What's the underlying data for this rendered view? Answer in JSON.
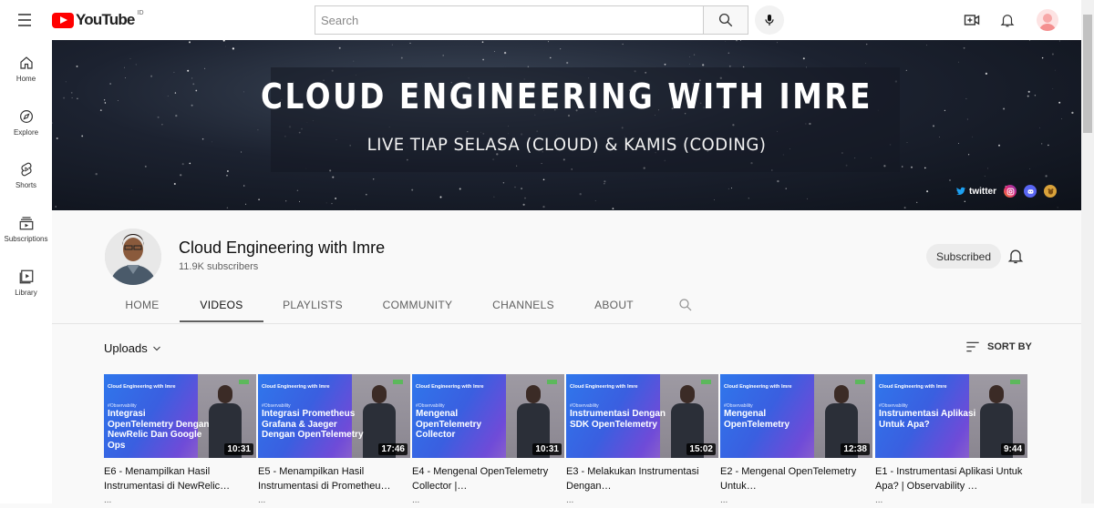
{
  "header": {
    "logo_text": "YouTube",
    "country_code": "ID",
    "search_placeholder": "Search",
    "icons": [
      "menu-icon",
      "search-icon",
      "mic-icon",
      "create-video-icon",
      "notifications-bell-icon",
      "avatar"
    ]
  },
  "sidebar": {
    "items": [
      {
        "label": "Home",
        "icon": "home-icon"
      },
      {
        "label": "Explore",
        "icon": "explore-compass-icon"
      },
      {
        "label": "Shorts",
        "icon": "shorts-icon"
      },
      {
        "label": "Subscriptions",
        "icon": "subscriptions-icon"
      },
      {
        "label": "Library",
        "icon": "library-icon"
      }
    ]
  },
  "banner": {
    "title": "CLOUD ENGINEERING WITH IMRE",
    "subtitle": "LIVE TIAP SELASA (CLOUD) & KAMIS (CODING)",
    "links": [
      {
        "label": "twitter",
        "icon": "twitter-icon"
      },
      {
        "label": "",
        "icon": "instagram-icon"
      },
      {
        "label": "",
        "icon": "discord-icon"
      },
      {
        "label": "",
        "icon": "web-icon"
      }
    ]
  },
  "channel": {
    "name": "Cloud Engineering with Imre",
    "subscribers": "11.9K subscribers",
    "subscribe_label": "Subscribed"
  },
  "tabs": [
    {
      "label": "HOME",
      "active": false
    },
    {
      "label": "VIDEOS",
      "active": true
    },
    {
      "label": "PLAYLISTS",
      "active": false
    },
    {
      "label": "COMMUNITY",
      "active": false
    },
    {
      "label": "CHANNELS",
      "active": false
    },
    {
      "label": "ABOUT",
      "active": false
    }
  ],
  "content": {
    "uploads_label": "Uploads",
    "sort_label": "SORT BY"
  },
  "videos": [
    {
      "thumb_top": "Cloud Engineering with Imre",
      "tag": "#Observability",
      "thumb_title": "Integrasi OpenTelemetry Dengan NewRelic Dan Google Ops",
      "duration": "10:31",
      "title": "E6 - Menampilkan Hasil Instrumentasi di NewRelic…",
      "meta": "..."
    },
    {
      "thumb_top": "Cloud Engineering with Imre",
      "tag": "#Observability",
      "thumb_title": "Integrasi Prometheus Grafana & Jaeger Dengan OpenTelemetry",
      "duration": "17:46",
      "title": "E5 - Menampilkan Hasil Instrumentasi di Prometheu…",
      "meta": "..."
    },
    {
      "thumb_top": "Cloud Engineering with Imre",
      "tag": "#Observability",
      "thumb_title": "Mengenal OpenTelemetry Collector",
      "duration": "10:31",
      "title": "E4 - Mengenal OpenTelemetry Collector |…",
      "meta": "..."
    },
    {
      "thumb_top": "Cloud Engineering with Imre",
      "tag": "#Observability",
      "thumb_title": "Instrumentasi Dengan SDK OpenTelemetry",
      "duration": "15:02",
      "title": "E3 - Melakukan Instrumentasi Dengan…",
      "meta": "..."
    },
    {
      "thumb_top": "Cloud Engineering with Imre",
      "tag": "#Observability",
      "thumb_title": "Mengenal OpenTelemetry",
      "duration": "12:38",
      "title": "E2 - Mengenal OpenTelemetry Untuk…",
      "meta": "..."
    },
    {
      "thumb_top": "Cloud Engineering with Imre",
      "tag": "#Observability",
      "thumb_title": "Instrumentasi Aplikasi Untuk Apa?",
      "duration": "9:44",
      "title": "E1 - Instrumentasi Aplikasi Untuk Apa? | Observability …",
      "meta": "..."
    }
  ],
  "colors": {
    "brand_red": "#ff0000",
    "thumb_blue": "#2f77ec",
    "text_primary": "#0f0f0f",
    "text_secondary": "#606060"
  }
}
